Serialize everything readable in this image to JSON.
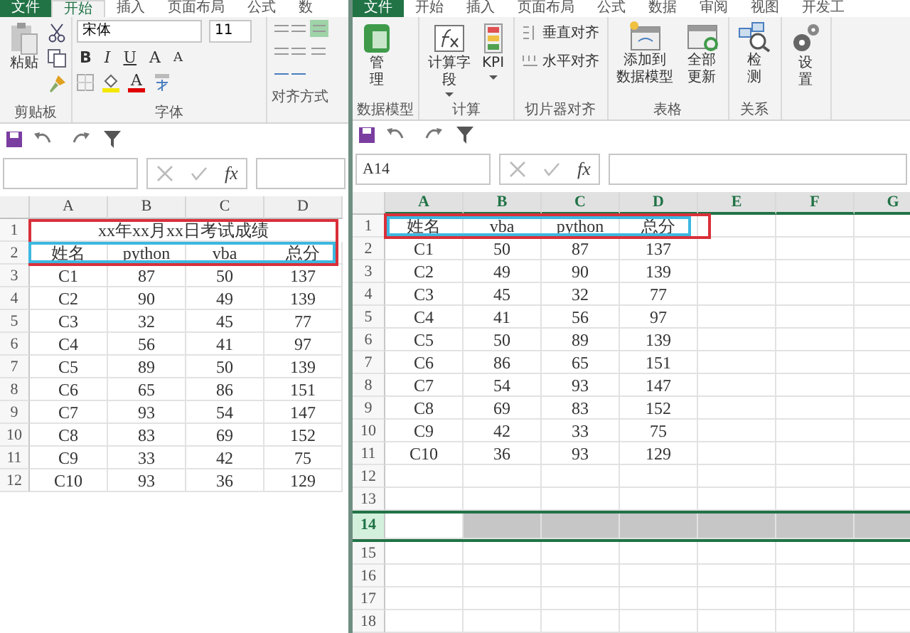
{
  "left_window": {
    "tabs": [
      {
        "label": "文件",
        "kind": "file",
        "selected": false
      },
      {
        "label": "开始",
        "kind": "tab",
        "selected": true
      },
      {
        "label": "插入",
        "kind": "tab",
        "selected": false
      },
      {
        "label": "页面布局",
        "kind": "tab",
        "selected": false
      },
      {
        "label": "公式",
        "kind": "tab",
        "selected": false
      },
      {
        "label": "数",
        "kind": "tab",
        "selected": false
      }
    ],
    "ribbon": {
      "clipboard": {
        "paste": "粘贴",
        "label": "剪贴板"
      },
      "font": {
        "name": "宋体",
        "size": "11",
        "bold": "B",
        "italic": "I",
        "underline": "U",
        "grow": "A",
        "shrink": "A",
        "font_color_letter": "A",
        "label": "字体"
      },
      "alignment": {
        "label": "对齐方式"
      }
    },
    "formula_bar": {
      "fx": "fx"
    },
    "sheet": {
      "columns": [
        {
          "label": "A",
          "selected": false
        },
        {
          "label": "B",
          "selected": false
        },
        {
          "label": "C",
          "selected": false
        },
        {
          "label": "D",
          "selected": false
        }
      ],
      "rows": [
        {
          "number": "1",
          "kind": "title",
          "title": "xx年xx月xx日考试成绩",
          "selected": false
        },
        {
          "number": "2",
          "kind": "data",
          "cells": [
            "姓名",
            "python",
            "vba",
            "总分"
          ],
          "selected": false
        },
        {
          "number": "3",
          "kind": "data",
          "cells": [
            "C1",
            "87",
            "50",
            "137"
          ],
          "selected": false
        },
        {
          "number": "4",
          "kind": "data",
          "cells": [
            "C2",
            "90",
            "49",
            "139"
          ],
          "selected": false
        },
        {
          "number": "5",
          "kind": "data",
          "cells": [
            "C3",
            "32",
            "45",
            "77"
          ],
          "selected": false
        },
        {
          "number": "6",
          "kind": "data",
          "cells": [
            "C4",
            "56",
            "41",
            "97"
          ],
          "selected": false
        },
        {
          "number": "7",
          "kind": "data",
          "cells": [
            "C5",
            "89",
            "50",
            "139"
          ],
          "selected": false
        },
        {
          "number": "8",
          "kind": "data",
          "cells": [
            "C6",
            "65",
            "86",
            "151"
          ],
          "selected": false
        },
        {
          "number": "9",
          "kind": "data",
          "cells": [
            "C7",
            "93",
            "54",
            "147"
          ],
          "selected": false
        },
        {
          "number": "10",
          "kind": "data",
          "cells": [
            "C8",
            "83",
            "69",
            "152"
          ],
          "selected": false
        },
        {
          "number": "11",
          "kind": "data",
          "cells": [
            "C9",
            "33",
            "42",
            "75"
          ],
          "selected": false
        },
        {
          "number": "12",
          "kind": "data",
          "cells": [
            "C10",
            "93",
            "36",
            "129"
          ],
          "selected": false
        }
      ]
    }
  },
  "right_window": {
    "tabs": [
      {
        "label": "文件",
        "kind": "file",
        "selected": false
      },
      {
        "label": "开始",
        "kind": "tab",
        "selected": false
      },
      {
        "label": "插入",
        "kind": "tab",
        "selected": false
      },
      {
        "label": "页面布局",
        "kind": "tab",
        "selected": false
      },
      {
        "label": "公式",
        "kind": "tab",
        "selected": false
      },
      {
        "label": "数据",
        "kind": "tab",
        "selected": false
      },
      {
        "label": "审阅",
        "kind": "tab",
        "selected": false
      },
      {
        "label": "视图",
        "kind": "tab",
        "selected": false
      },
      {
        "label": "开发工",
        "kind": "tab",
        "selected": false
      }
    ],
    "ribbon": {
      "groups": [
        {
          "label": "数据模型",
          "buttons": [
            {
              "kind": "manage",
              "lines": [
                "管",
                "理"
              ]
            }
          ]
        },
        {
          "label": "计算",
          "buttons": [
            {
              "kind": "fx",
              "lines": [
                "计算字",
                "段"
              ],
              "dropdown": true
            },
            {
              "kind": "kpi",
              "lines": [
                "KPI"
              ],
              "dropdown": true
            }
          ]
        },
        {
          "label": "切片器对齐",
          "buttons": [
            {
              "kind": "valign",
              "lines": [
                "垂直对齐"
              ]
            },
            {
              "kind": "halign",
              "lines": [
                "水平对齐"
              ]
            }
          ]
        },
        {
          "label": "表格",
          "buttons": [
            {
              "kind": "add",
              "lines": [
                "添加到",
                "数据模型"
              ]
            },
            {
              "kind": "refresh",
              "lines": [
                "全部",
                "更新"
              ]
            }
          ]
        },
        {
          "label": "关系",
          "buttons": [
            {
              "kind": "detect",
              "lines": [
                "检",
                "测"
              ]
            }
          ]
        },
        {
          "buttons": [
            {
              "kind": "settings",
              "lines": [
                "设",
                "置"
              ]
            }
          ]
        }
      ]
    },
    "name_box": "A14",
    "formula_bar": {
      "fx": "fx"
    },
    "sheet": {
      "columns": [
        {
          "label": "A",
          "selected": true
        },
        {
          "label": "B",
          "selected": true
        },
        {
          "label": "C",
          "selected": true
        },
        {
          "label": "D",
          "selected": true
        },
        {
          "label": "E",
          "selected": true
        },
        {
          "label": "F",
          "selected": true
        },
        {
          "label": "G",
          "selected": true
        }
      ],
      "rows": [
        {
          "number": "1",
          "kind": "data",
          "cells": [
            "姓名",
            "vba",
            "python",
            "总分"
          ],
          "selected": false
        },
        {
          "number": "2",
          "kind": "data",
          "cells": [
            "C1",
            "50",
            "87",
            "137"
          ],
          "selected": false
        },
        {
          "number": "3",
          "kind": "data",
          "cells": [
            "C2",
            "49",
            "90",
            "139"
          ],
          "selected": false
        },
        {
          "number": "4",
          "kind": "data",
          "cells": [
            "C3",
            "45",
            "32",
            "77"
          ],
          "selected": false
        },
        {
          "number": "5",
          "kind": "data",
          "cells": [
            "C4",
            "41",
            "56",
            "97"
          ],
          "selected": false
        },
        {
          "number": "6",
          "kind": "data",
          "cells": [
            "C5",
            "50",
            "89",
            "139"
          ],
          "selected": false
        },
        {
          "number": "7",
          "kind": "data",
          "cells": [
            "C6",
            "86",
            "65",
            "151"
          ],
          "selected": false
        },
        {
          "number": "8",
          "kind": "data",
          "cells": [
            "C7",
            "54",
            "93",
            "147"
          ],
          "selected": false
        },
        {
          "number": "9",
          "kind": "data",
          "cells": [
            "C8",
            "69",
            "83",
            "152"
          ],
          "selected": false
        },
        {
          "number": "10",
          "kind": "data",
          "cells": [
            "C9",
            "42",
            "33",
            "75"
          ],
          "selected": false
        },
        {
          "number": "11",
          "kind": "data",
          "cells": [
            "C10",
            "36",
            "93",
            "129"
          ],
          "selected": false
        },
        {
          "number": "12",
          "kind": "data",
          "selected": false
        },
        {
          "number": "13",
          "kind": "data",
          "selected": false
        },
        {
          "number": "14",
          "kind": "data",
          "selected": true
        },
        {
          "number": "15",
          "kind": "data",
          "selected": false
        },
        {
          "number": "16",
          "kind": "data",
          "selected": false
        },
        {
          "number": "17",
          "kind": "data",
          "selected": false
        },
        {
          "number": "18",
          "kind": "data",
          "selected": false
        }
      ]
    }
  }
}
